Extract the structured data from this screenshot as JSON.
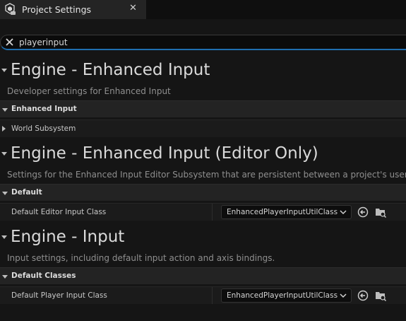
{
  "tab": {
    "title": "Project Settings",
    "close_icon": "close-icon",
    "app_icon": "unreal-settings-icon"
  },
  "search": {
    "value": "playerinput",
    "placeholder": ""
  },
  "sections": [
    {
      "title": "Engine - Enhanced Input",
      "description": "Developer settings for Enhanced Input",
      "category": "Enhanced Input",
      "rows": [
        {
          "label": "World Subsystem",
          "collapsed": true
        }
      ]
    },
    {
      "title": "Engine - Enhanced Input (Editor Only)",
      "description": "Settings for the Enhanced Input Editor Subsystem that are persistent between a project's users",
      "category": "Default",
      "rows": [
        {
          "label": "Default Editor Input Class",
          "value": "EnhancedPlayerInputUtilClass"
        }
      ]
    },
    {
      "title": "Engine - Input",
      "description": "Input settings, including default input action and axis bindings.",
      "category": "Default Classes",
      "rows": [
        {
          "label": "Default Player Input Class",
          "value": "EnhancedPlayerInputUtilClass"
        }
      ]
    }
  ],
  "colors": {
    "accent": "#1f6fb0",
    "background": "#151515",
    "panel": "#232323"
  }
}
